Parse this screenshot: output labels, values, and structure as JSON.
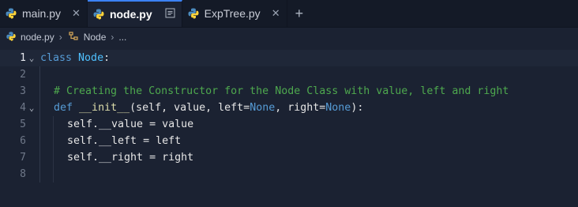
{
  "tabs": [
    {
      "label": "main.py",
      "active": false
    },
    {
      "label": "node.py",
      "active": true
    },
    {
      "label": "ExpTree.py",
      "active": false
    }
  ],
  "breadcrumb": {
    "file": "node.py",
    "symbol": "Node",
    "more": "..."
  },
  "editor": {
    "line_numbers": [
      "1",
      "2",
      "3",
      "4",
      "5",
      "6",
      "7",
      "8"
    ],
    "line1": {
      "kw": "class",
      "name": "Node",
      "colon": ":"
    },
    "line3": {
      "comment": "# Creating the Constructor for the Node Class with value, left and right"
    },
    "line4": {
      "kw": "def",
      "fn": "__init__",
      "open": "(self, value, left=",
      "none1": "None",
      "mid": ", right=",
      "none2": "None",
      "close": "):"
    },
    "line5": {
      "text": "self.__value = value"
    },
    "line6": {
      "text": "self.__left = left"
    },
    "line7": {
      "text": "self.__right = right"
    }
  },
  "colors": {
    "background": "#1b2232",
    "keyword": "#569cd6",
    "class_name": "#4fc1ff",
    "function": "#dcdcaa",
    "comment": "#4ea84e"
  },
  "icons": {
    "python_file": "python-icon",
    "preview": "split-preview-icon",
    "class_symbol": "class-symbol-icon"
  }
}
